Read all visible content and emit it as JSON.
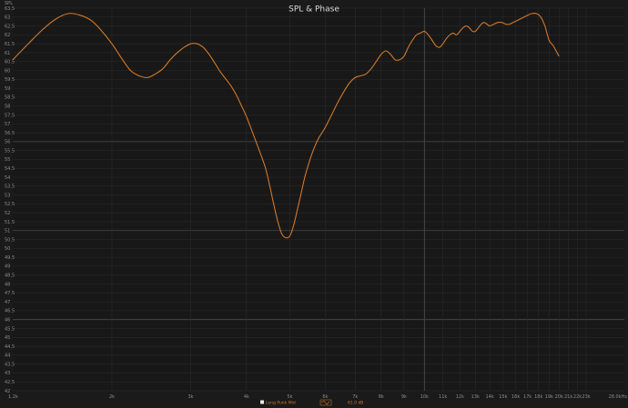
{
  "chart_data": {
    "type": "line",
    "title": "SPL & Phase",
    "ylabel": "SPL",
    "x_scale": "log",
    "xlim": [
      1200,
      28000
    ],
    "ylim": [
      42,
      63.5
    ],
    "grid": true,
    "legend_placement": "bottom-center",
    "y_ticks": [
      {
        "v": 63.5,
        "label": "63.5"
      },
      {
        "v": 63,
        "label": "63"
      },
      {
        "v": 62.5,
        "label": "62.5"
      },
      {
        "v": 62,
        "label": "62"
      },
      {
        "v": 61.5,
        "label": "61.5"
      },
      {
        "v": 61,
        "label": "61"
      },
      {
        "v": 60.5,
        "label": "60.5"
      },
      {
        "v": 60,
        "label": "60"
      },
      {
        "v": 59.5,
        "label": "59.5"
      },
      {
        "v": 59,
        "label": "59"
      },
      {
        "v": 58.5,
        "label": "58.5"
      },
      {
        "v": 58,
        "label": "58"
      },
      {
        "v": 57.5,
        "label": "57.5"
      },
      {
        "v": 57,
        "label": "57"
      },
      {
        "v": 56.5,
        "label": "56.5"
      },
      {
        "v": 56,
        "label": "56"
      },
      {
        "v": 55.5,
        "label": "55.5"
      },
      {
        "v": 55,
        "label": "55"
      },
      {
        "v": 54.5,
        "label": "54.5"
      },
      {
        "v": 54,
        "label": "54"
      },
      {
        "v": 53.5,
        "label": "53.5"
      },
      {
        "v": 53,
        "label": "53"
      },
      {
        "v": 52.5,
        "label": "52.5"
      },
      {
        "v": 52,
        "label": "52"
      },
      {
        "v": 51.5,
        "label": "51.5"
      },
      {
        "v": 51,
        "label": "51"
      },
      {
        "v": 50.5,
        "label": "50.5"
      },
      {
        "v": 50,
        "label": "50"
      },
      {
        "v": 49.5,
        "label": "49.5"
      },
      {
        "v": 49,
        "label": "49"
      },
      {
        "v": 48.5,
        "label": "48.5"
      },
      {
        "v": 48,
        "label": "48"
      },
      {
        "v": 47.5,
        "label": "47.5"
      },
      {
        "v": 47,
        "label": "47"
      },
      {
        "v": 46.5,
        "label": "46.5"
      },
      {
        "v": 46,
        "label": "46"
      },
      {
        "v": 45.5,
        "label": "45.5"
      },
      {
        "v": 45,
        "label": "45"
      },
      {
        "v": 44.5,
        "label": "44.5"
      },
      {
        "v": 44,
        "label": "44"
      },
      {
        "v": 43.5,
        "label": "43.5"
      },
      {
        "v": 43,
        "label": "43"
      },
      {
        "v": 42.5,
        "label": "42.5"
      },
      {
        "v": 42,
        "label": "42"
      }
    ],
    "y_major": [
      56,
      51,
      46
    ],
    "x_ticks": [
      {
        "v": 1200,
        "label": "1.2k"
      },
      {
        "v": 2000,
        "label": "2k"
      },
      {
        "v": 3000,
        "label": "3k"
      },
      {
        "v": 4000,
        "label": "4k"
      },
      {
        "v": 5000,
        "label": "5k"
      },
      {
        "v": 6000,
        "label": "6k"
      },
      {
        "v": 7000,
        "label": "7k"
      },
      {
        "v": 8000,
        "label": "8k"
      },
      {
        "v": 9000,
        "label": "9k"
      },
      {
        "v": 10000,
        "label": "10k"
      },
      {
        "v": 11000,
        "label": "11k"
      },
      {
        "v": 12000,
        "label": "12k"
      },
      {
        "v": 13000,
        "label": "13k"
      },
      {
        "v": 14000,
        "label": "14k"
      },
      {
        "v": 15000,
        "label": "15k"
      },
      {
        "v": 16000,
        "label": "16k"
      },
      {
        "v": 17000,
        "label": "17k"
      },
      {
        "v": 18000,
        "label": "18k"
      },
      {
        "v": 19000,
        "label": "19k"
      },
      {
        "v": 20000,
        "label": "20k"
      },
      {
        "v": 21000,
        "label": "21k"
      },
      {
        "v": 22000,
        "label": "22k"
      },
      {
        "v": 23000,
        "label": "23k"
      },
      {
        "v": 28000,
        "label": "28.0kHz"
      }
    ],
    "x_major": [
      10000
    ],
    "series": [
      {
        "name": "Long Punk Mid",
        "color": "#d2782a",
        "x": [
          1200,
          1300,
          1400,
          1500,
          1600,
          1700,
          1800,
          1900,
          2000,
          2100,
          2200,
          2300,
          2400,
          2500,
          2600,
          2700,
          2800,
          2900,
          3000,
          3100,
          3200,
          3300,
          3400,
          3500,
          3600,
          3700,
          3800,
          3900,
          4000,
          4200,
          4400,
          4500,
          4600,
          4700,
          4800,
          4900,
          5000,
          5100,
          5200,
          5300,
          5400,
          5500,
          5600,
          5700,
          5800,
          5900,
          6000,
          6200,
          6400,
          6600,
          6800,
          7000,
          7200,
          7400,
          7600,
          7800,
          8000,
          8200,
          8400,
          8600,
          8800,
          9000,
          9200,
          9400,
          9600,
          9800,
          10000,
          10200,
          10400,
          10600,
          10800,
          11000,
          11200,
          11400,
          11600,
          11800,
          12000,
          12200,
          12400,
          12600,
          12800,
          13000,
          13200,
          13400,
          13600,
          13800,
          14000,
          14300,
          14600,
          14900,
          15200,
          15500,
          15800,
          16100,
          16400,
          16700,
          17000,
          17400,
          17800,
          18200,
          18600,
          19000,
          19400,
          19800,
          20000
        ],
        "y": [
          60.6,
          61.5,
          62.3,
          62.9,
          63.2,
          63.1,
          62.8,
          62.2,
          61.5,
          60.7,
          60.0,
          59.7,
          59.6,
          59.8,
          60.1,
          60.6,
          61.0,
          61.3,
          61.5,
          61.5,
          61.3,
          60.9,
          60.4,
          59.9,
          59.5,
          59.1,
          58.6,
          58.0,
          57.4,
          56.0,
          54.6,
          53.6,
          52.5,
          51.5,
          50.8,
          50.6,
          50.7,
          51.3,
          52.2,
          53.1,
          54.0,
          54.7,
          55.3,
          55.8,
          56.2,
          56.5,
          56.8,
          57.5,
          58.2,
          58.8,
          59.3,
          59.6,
          59.7,
          59.8,
          60.1,
          60.5,
          60.9,
          61.1,
          60.9,
          60.6,
          60.6,
          60.8,
          61.3,
          61.7,
          62.0,
          62.1,
          62.2,
          62.0,
          61.7,
          61.4,
          61.3,
          61.5,
          61.8,
          62.0,
          62.1,
          62.0,
          62.2,
          62.4,
          62.5,
          62.4,
          62.2,
          62.2,
          62.4,
          62.6,
          62.7,
          62.6,
          62.5,
          62.6,
          62.7,
          62.7,
          62.6,
          62.6,
          62.7,
          62.8,
          62.9,
          63.0,
          63.1,
          63.2,
          63.2,
          63.0,
          62.5,
          61.7,
          61.4,
          61.0,
          60.8
        ]
      },
      {
        "name": "61.0 dB",
        "color": "#d2782a",
        "x": [],
        "y": []
      }
    ]
  },
  "colors": {
    "background": "#1a1a1a",
    "grid": "#2c2c2c",
    "grid_major": "#4a4a4a",
    "axis_text": "#8c8c8c",
    "title": "#d8d8d8",
    "curve": "#d2782a"
  }
}
